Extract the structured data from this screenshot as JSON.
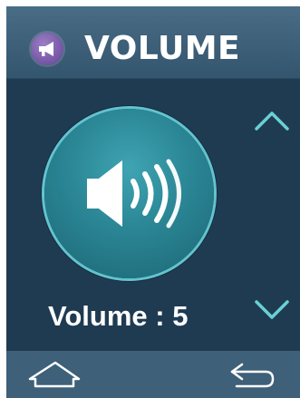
{
  "header": {
    "title": "VOLUME",
    "icon": "megaphone-icon"
  },
  "main": {
    "speaker_icon": "speaker-volume-icon",
    "volume_text": "Volume : 5",
    "volume_level": 5,
    "controls": {
      "increase_icon": "chevron-up-icon",
      "decrease_icon": "chevron-down-icon"
    }
  },
  "footer": {
    "home_icon": "home-icon",
    "back_icon": "back-arrow-icon"
  },
  "colors": {
    "header_bg": "#3e6079",
    "main_bg": "#1f3b52",
    "accent": "#62c4cf",
    "speaker_circle": "#2a8594",
    "header_icon_bg": "#7a5aa9",
    "text": "#ffffff"
  }
}
